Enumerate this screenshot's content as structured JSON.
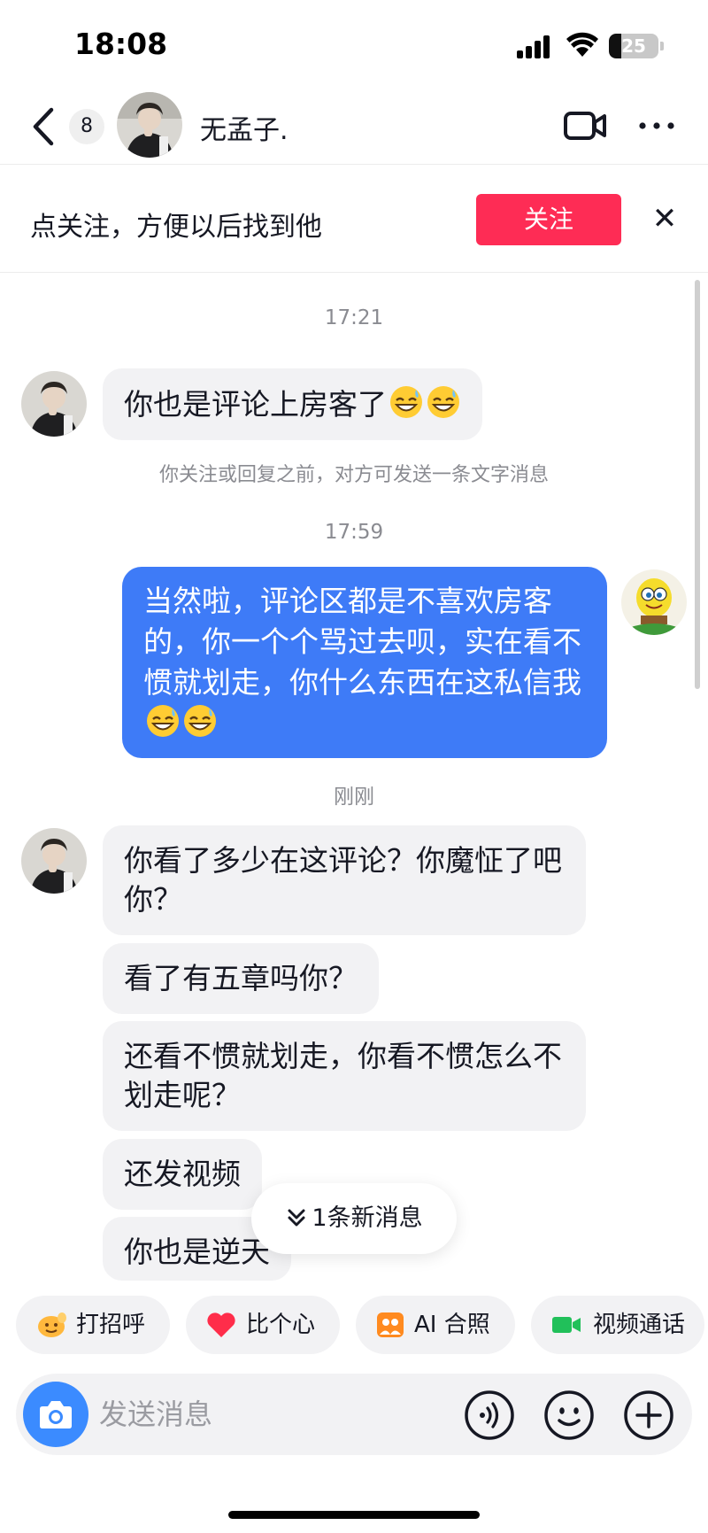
{
  "status_bar": {
    "time": "18:08",
    "battery_level": "25",
    "battery_fraction": 0.25
  },
  "header": {
    "unread_count": "8",
    "contact_name": "无孟子."
  },
  "follow_banner": {
    "text": "点关注，方便以后找到他",
    "button_label": "关注",
    "close_glyph": "✕"
  },
  "messages": {
    "timestamp_1": "17:21",
    "incoming_1": "你也是评论上房客了",
    "system_note": "你关注或回复之前，对方可发送一条文字消息",
    "timestamp_2": "17:59",
    "outgoing_1": "当然啦，评论区都是不喜欢房客的，你一个个骂过去呗，实在看不惯就划走，你什么东西在这私信我",
    "timestamp_3": "刚刚",
    "incoming_2": "你看了多少在这评论？你魔怔了吧你？",
    "incoming_3": "看了有五章吗你？",
    "incoming_4": "还看不惯就划走，你看不惯怎么不划走呢？",
    "incoming_5": "还发视频",
    "incoming_6": "你也是逆天"
  },
  "new_message_pill": {
    "label": "1条新消息"
  },
  "quick_actions": {
    "greet": "打招呼",
    "heart": "比个心",
    "ai_photo": "AI 合照",
    "video_call": "视频通话"
  },
  "input": {
    "placeholder": "发送消息"
  },
  "colors": {
    "accent_red": "#fe2c55",
    "outgoing_bubble": "#3e7bf7",
    "camera_blue": "#3b8bff"
  },
  "icons": [
    "back-chevron-icon",
    "video-camera-icon",
    "more-dots-icon",
    "close-icon",
    "sweat-smile-emoji",
    "chevron-double-down-icon",
    "wave-hand-icon",
    "heart-icon",
    "ai-photo-icon",
    "video-call-icon",
    "camera-icon",
    "voice-icon",
    "emoji-icon",
    "plus-icon"
  ]
}
